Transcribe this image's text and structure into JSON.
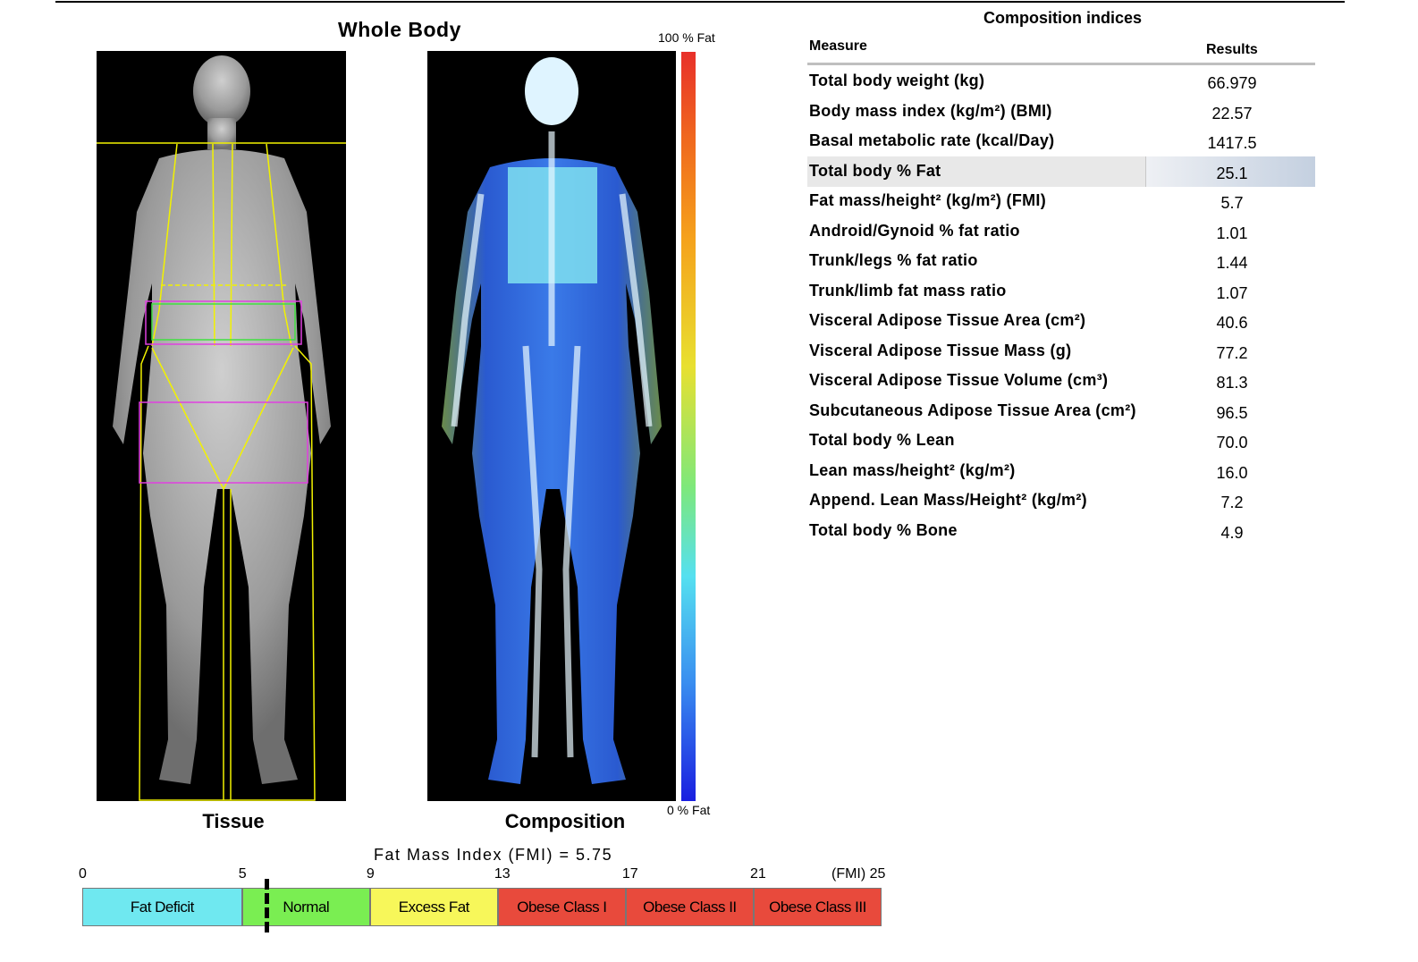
{
  "header": {
    "whole_body": "Whole Body",
    "tissue": "Tissue",
    "composition": "Composition",
    "scale_top": "100 % Fat",
    "scale_bottom": "0 % Fat"
  },
  "table": {
    "title": "Composition indices",
    "col_measure": "Measure",
    "col_results": "Results",
    "rows": [
      {
        "measure": "Total body weight (kg)",
        "value": "66.979"
      },
      {
        "measure": "Body mass index (kg/m²) (BMI)",
        "value": "22.57"
      },
      {
        "measure": "Basal metabolic rate (kcal/Day)",
        "value": "1417.5"
      },
      {
        "measure": "Total body % Fat",
        "value": "25.1"
      },
      {
        "measure": "Fat mass/height² (kg/m²) (FMI)",
        "value": "5.7"
      },
      {
        "measure": "Android/Gynoid % fat ratio",
        "value": "1.01"
      },
      {
        "measure": "Trunk/legs % fat ratio",
        "value": "1.44"
      },
      {
        "measure": "Trunk/limb fat mass ratio",
        "value": "1.07"
      },
      {
        "measure": "Visceral Adipose Tissue Area (cm²)",
        "value": "40.6"
      },
      {
        "measure": "Visceral Adipose Tissue Mass (g)",
        "value": "77.2"
      },
      {
        "measure": "Visceral Adipose Tissue Volume (cm³)",
        "value": "81.3"
      },
      {
        "measure": "Subcutaneous Adipose Tissue Area (cm²)",
        "value": "96.5"
      },
      {
        "measure": "Total body % Lean",
        "value": "70.0"
      },
      {
        "measure": "Lean mass/height² (kg/m²)",
        "value": "16.0"
      },
      {
        "measure": "Append. Lean Mass/Height² (kg/m²)",
        "value": "7.2"
      },
      {
        "measure": "Total body % Bone",
        "value": "4.9"
      }
    ]
  },
  "fmi": {
    "title": "Fat Mass Index (FMI) = 5.75",
    "value": 5.75,
    "range": [
      0,
      25
    ],
    "ticks": [
      "0",
      "5",
      "9",
      "13",
      "17",
      "21"
    ],
    "end_label": "(FMI) 25",
    "categories": [
      {
        "label": "Fat Deficit",
        "from": 0,
        "to": 5,
        "color": "#6fe8f0"
      },
      {
        "label": "Normal",
        "from": 5,
        "to": 9,
        "color": "#7aee52"
      },
      {
        "label": "Excess Fat",
        "from": 9,
        "to": 13,
        "color": "#f7f75a"
      },
      {
        "label": "Obese Class I",
        "from": 13,
        "to": 17,
        "color": "#e84a3c"
      },
      {
        "label": "Obese Class II",
        "from": 17,
        "to": 21,
        "color": "#e84a3c"
      },
      {
        "label": "Obese Class III",
        "from": 21,
        "to": 25,
        "color": "#e84a3c"
      }
    ]
  }
}
